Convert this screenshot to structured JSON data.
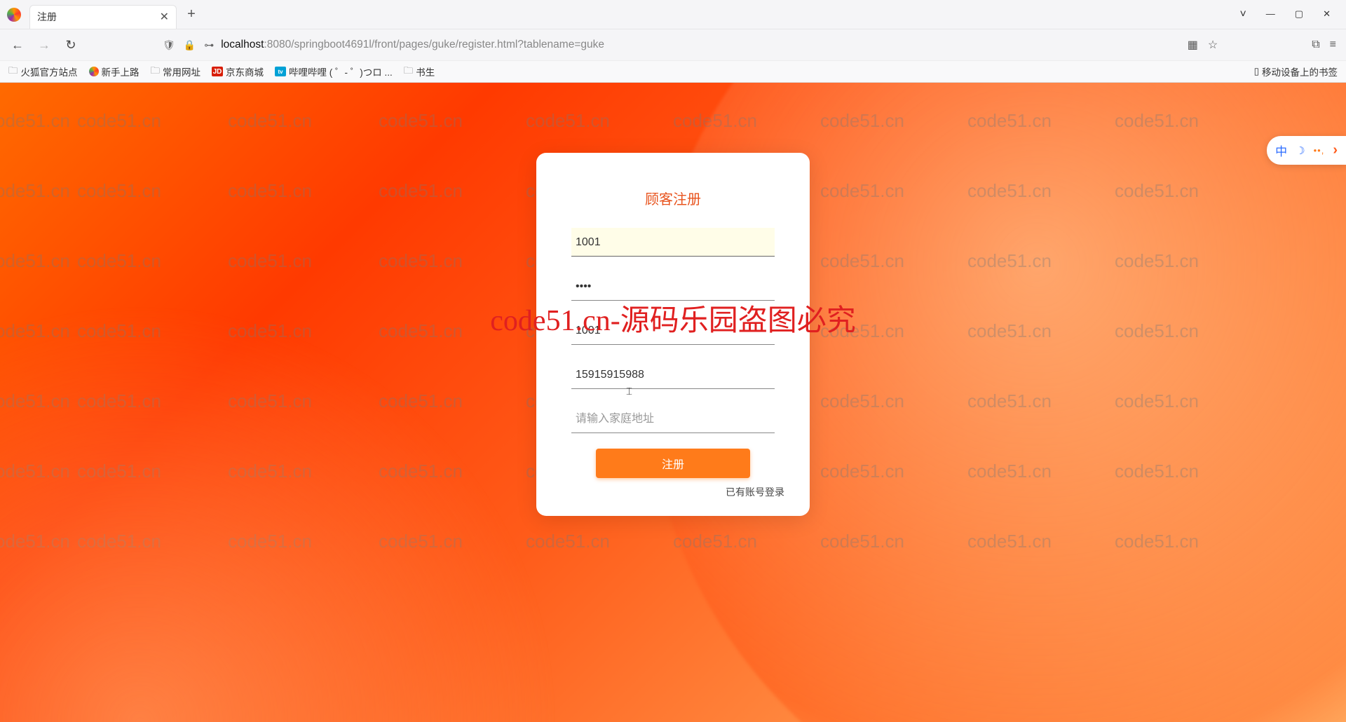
{
  "browser": {
    "tab_title": "注册",
    "new_tab": "+",
    "window": {
      "chev": "˅",
      "min": "—",
      "max": "▢",
      "close": "✕"
    },
    "nav": {
      "back": "←",
      "fwd": "→",
      "reload": "↻"
    },
    "url_icons": {
      "shield": "🛡",
      "lock": "🔒",
      "key": "⊶"
    },
    "url": {
      "host": "localhost",
      "rest": ":8080/springboot4691l/front/pages/guke/register.html?tablename=guke"
    },
    "right_icons": {
      "qr": "▦",
      "star": "☆",
      "ext": "⧉",
      "menu": "≡"
    },
    "bookmarks": [
      {
        "type": "folder",
        "label": "火狐官方站点"
      },
      {
        "type": "ff",
        "label": "新手上路"
      },
      {
        "type": "folder",
        "label": "常用网址"
      },
      {
        "type": "jd",
        "label": "京东商城"
      },
      {
        "type": "bili",
        "label": "哔哩哔哩 (  ゜- ゜)つロ ..."
      },
      {
        "type": "folder",
        "label": "书生"
      }
    ],
    "mobile_bookmarks": "移动设备上的书签"
  },
  "watermark_text": "code51.cn",
  "watermark_big": "code51.cn-源码乐园盗图必究",
  "side": {
    "cn": "中",
    "moon": "☽",
    "dots": "••,",
    "arr": "›"
  },
  "form": {
    "title": "顾客注册",
    "username": "1001",
    "password": "••••",
    "confirm": "1001",
    "phone": "15915915988",
    "address_placeholder": "请输入家庭地址",
    "submit": "注册",
    "login_link": "已有账号登录"
  }
}
